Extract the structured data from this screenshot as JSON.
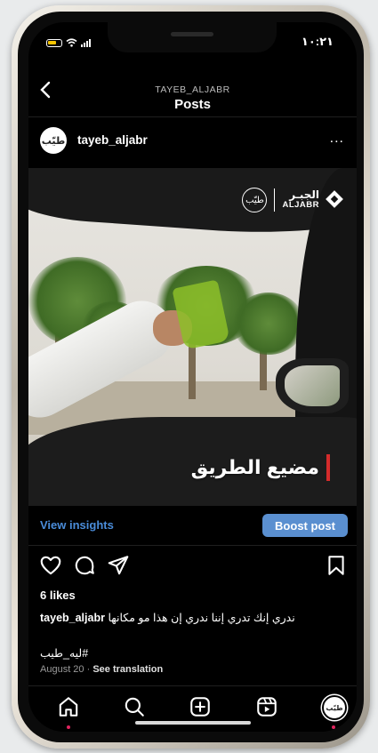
{
  "status_bar": {
    "time": "١٠:٢١"
  },
  "header": {
    "subtitle": "TAYEB_ALJABR",
    "title": "Posts",
    "back_icon": "chevron-left-icon"
  },
  "post": {
    "username": "tayeb_aljabr",
    "more_label": "...",
    "image": {
      "overlay_text": "مضيع الطريق",
      "brand_ar": "الجبـر",
      "brand_en": "ALJABR",
      "avatar_text": "طيّب"
    },
    "insights_label": "View insights",
    "boost_label": "Boost post",
    "likes": "6 likes",
    "caption_user": "tayeb_aljabr",
    "caption_text": "ندري إنك تدري إننا ندري إن هذا مو مكانها",
    "hashtag": "#ليه_طيب",
    "date": "August 20",
    "separator": "·",
    "see_translation": "See translation"
  },
  "actions": [
    "heart-icon",
    "comment-icon",
    "share-icon",
    "bookmark-icon"
  ],
  "bottom_nav": [
    "home-icon",
    "search-icon",
    "create-icon",
    "reels-icon",
    "profile-avatar"
  ],
  "colors": {
    "link_blue": "#4a8cd9",
    "boost_blue": "#5a8fd0",
    "accent_red": "#d42b2b",
    "notif_dot": "#e0245e"
  }
}
